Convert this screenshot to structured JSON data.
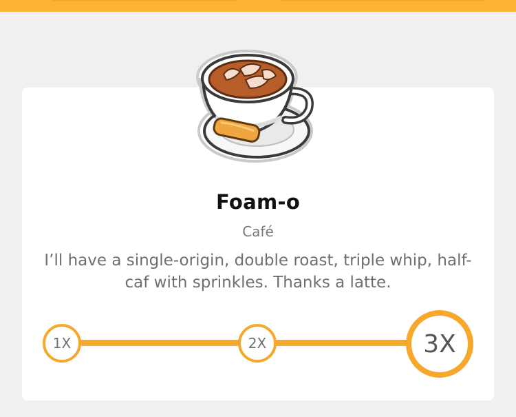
{
  "colors": {
    "accent": "#f5a82b",
    "top_bar": "#fdb135",
    "background": "#f0f0f0",
    "card": "#ffffff"
  },
  "badge": {
    "icon": "coffee-cup-icon",
    "title": "Foam-o",
    "category": "Café",
    "description": "I’ll have a single-origin, double roast, triple whip, half-caf with sprinkles. Thanks a latte."
  },
  "levels": {
    "items": [
      {
        "label": "1X"
      },
      {
        "label": "2X"
      },
      {
        "label": "3X"
      }
    ],
    "current": "3X"
  }
}
